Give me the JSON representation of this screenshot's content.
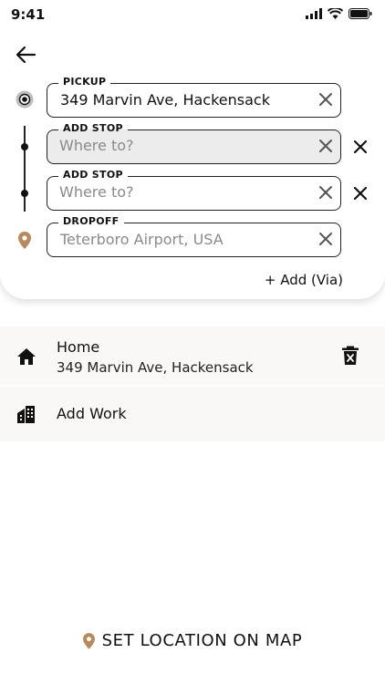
{
  "status_bar": {
    "time": "9:41"
  },
  "fields": {
    "pickup": {
      "label": "PICKUP",
      "value": "349 Marvin Ave, Hackensack"
    },
    "stop1": {
      "label": "ADD STOP",
      "placeholder": "Where to?"
    },
    "stop2": {
      "label": "ADD STOP",
      "placeholder": "Where to?"
    },
    "dropoff": {
      "label": "DROPOFF",
      "value": "Teterboro Airport, USA"
    }
  },
  "add_via": "+ Add (Via)",
  "saved": {
    "home": {
      "title": "Home",
      "address": "349 Marvin Ave, Hackensack"
    },
    "work": {
      "title": "Add Work"
    }
  },
  "set_location": "SET LOCATION ON MAP",
  "colors": {
    "accent": "#b58a5e",
    "filled_field": "#ececec",
    "saved_bg": "#faf8f6"
  }
}
